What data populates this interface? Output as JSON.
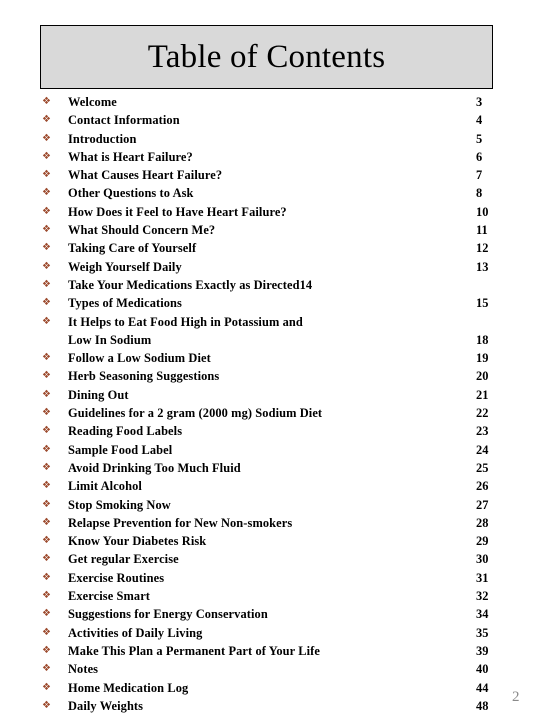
{
  "header": {
    "title": "Table of Contents",
    "background_color": "#d9d9d9",
    "border_color": "#000000"
  },
  "bullet": {
    "glyph": "❖",
    "icon_name": "diamond-bullet-icon",
    "color": "#9c4a2d"
  },
  "footer": {
    "page_number": "2",
    "color": "#8a8a8a"
  },
  "toc": {
    "entries": [
      {
        "title": "Welcome",
        "page": "3",
        "inline_page": false
      },
      {
        "title": "Contact Information",
        "page": "4",
        "inline_page": false
      },
      {
        "title": "Introduction",
        "page": "5",
        "inline_page": false
      },
      {
        "title": "What is Heart Failure?",
        "page": "6",
        "inline_page": false
      },
      {
        "title": "What Causes Heart Failure?",
        "page": "7",
        "inline_page": false
      },
      {
        "title": "Other Questions to Ask",
        "page": "8",
        "inline_page": false
      },
      {
        "title": "How Does it Feel to Have Heart Failure?",
        "page": "10",
        "inline_page": false
      },
      {
        "title": "What Should Concern Me?",
        "page": "11",
        "inline_page": false
      },
      {
        "title": "Taking Care of Yourself",
        "page": "12",
        "inline_page": false
      },
      {
        "title": "Weigh Yourself Daily",
        "page": "13",
        "inline_page": false
      },
      {
        "title": "Take Your Medications Exactly as Directed14",
        "page": "",
        "inline_page": true
      },
      {
        "title": "Types of Medications",
        "page": "15",
        "inline_page": false
      },
      {
        "title": "It Helps to Eat Food High in Potassium and\nLow In Sodium",
        "page": "18",
        "inline_page": false,
        "two_line": true
      },
      {
        "title": "Follow a Low Sodium Diet",
        "page": "19",
        "inline_page": false
      },
      {
        "title": "Herb Seasoning Suggestions",
        "page": "20",
        "inline_page": false
      },
      {
        "title": "Dining Out",
        "page": "21",
        "inline_page": false
      },
      {
        "title": "Guidelines for a 2 gram (2000 mg) Sodium Diet",
        "page": "22",
        "inline_page": false
      },
      {
        "title": "Reading Food Labels",
        "page": "23",
        "inline_page": false
      },
      {
        "title": "Sample Food Label",
        "page": "24",
        "inline_page": false
      },
      {
        "title": "Avoid Drinking Too Much Fluid",
        "page": "25",
        "inline_page": false
      },
      {
        "title": "Limit Alcohol",
        "page": "26",
        "inline_page": false
      },
      {
        "title": "Stop Smoking Now",
        "page": "27",
        "inline_page": false
      },
      {
        "title": "Relapse Prevention for New Non-smokers",
        "page": "28",
        "inline_page": false
      },
      {
        "title": "Know Your Diabetes Risk",
        "page": "29",
        "inline_page": false
      },
      {
        "title": "Get regular Exercise",
        "page": "30",
        "inline_page": false
      },
      {
        "title": "Exercise Routines",
        "page": "31",
        "inline_page": false
      },
      {
        "title": "Exercise Smart",
        "page": "32",
        "inline_page": false
      },
      {
        "title": "Suggestions for Energy Conservation",
        "page": "34",
        "inline_page": false
      },
      {
        "title": "Activities of Daily Living",
        "page": "35",
        "inline_page": false
      },
      {
        "title": "Make This Plan a Permanent Part of Your Life",
        "page": "39",
        "inline_page": false
      },
      {
        "title": "Notes",
        "page": "40",
        "inline_page": false
      },
      {
        "title": "Home Medication Log",
        "page": "44",
        "inline_page": false
      },
      {
        "title": "Daily Weights",
        "page": "48",
        "inline_page": false
      }
    ]
  }
}
